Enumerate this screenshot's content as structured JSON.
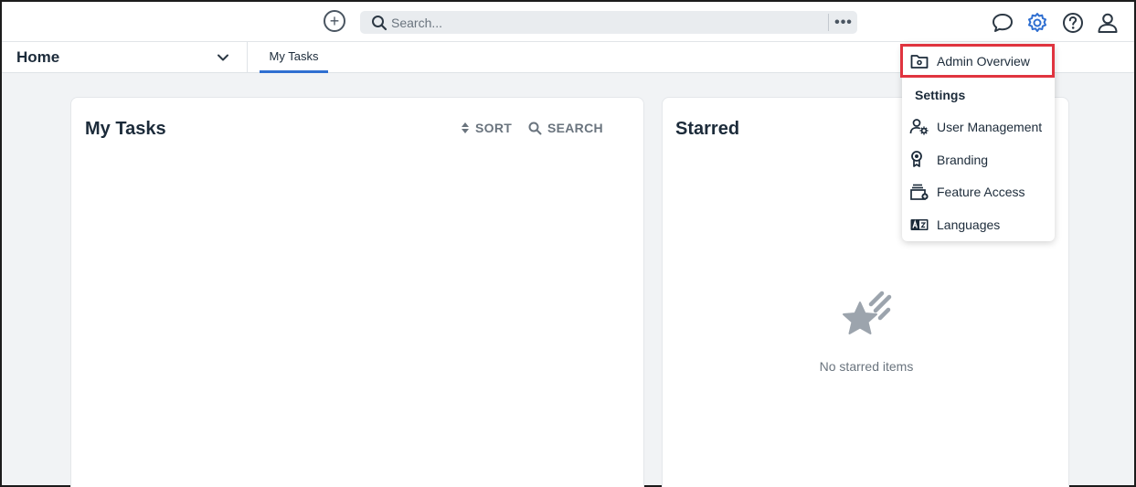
{
  "topbar": {
    "add_icon": "plus-circle-icon",
    "search": {
      "placeholder": "Search..."
    },
    "more_label": "•••",
    "icons": [
      "chat-icon",
      "gear-icon",
      "help-icon",
      "user-icon"
    ],
    "accent_color": "#2f6fd1"
  },
  "navbar": {
    "home_label": "Home",
    "tabs": [
      {
        "label": "My Tasks",
        "active": true
      }
    ]
  },
  "cards": {
    "tasks": {
      "title": "My Tasks",
      "sort_label": "SORT",
      "search_label": "SEARCH"
    },
    "starred": {
      "title": "Starred",
      "empty_text": "No starred items"
    }
  },
  "dropdown": {
    "admin_overview": "Admin Overview",
    "section_title": "Settings",
    "items": [
      {
        "label": "User Management",
        "icon": "user-gear-icon"
      },
      {
        "label": "Branding",
        "icon": "badge-icon"
      },
      {
        "label": "Feature Access",
        "icon": "feature-access-icon"
      },
      {
        "label": "Languages",
        "icon": "language-icon"
      }
    ],
    "highlight_color": "#e0343f"
  }
}
